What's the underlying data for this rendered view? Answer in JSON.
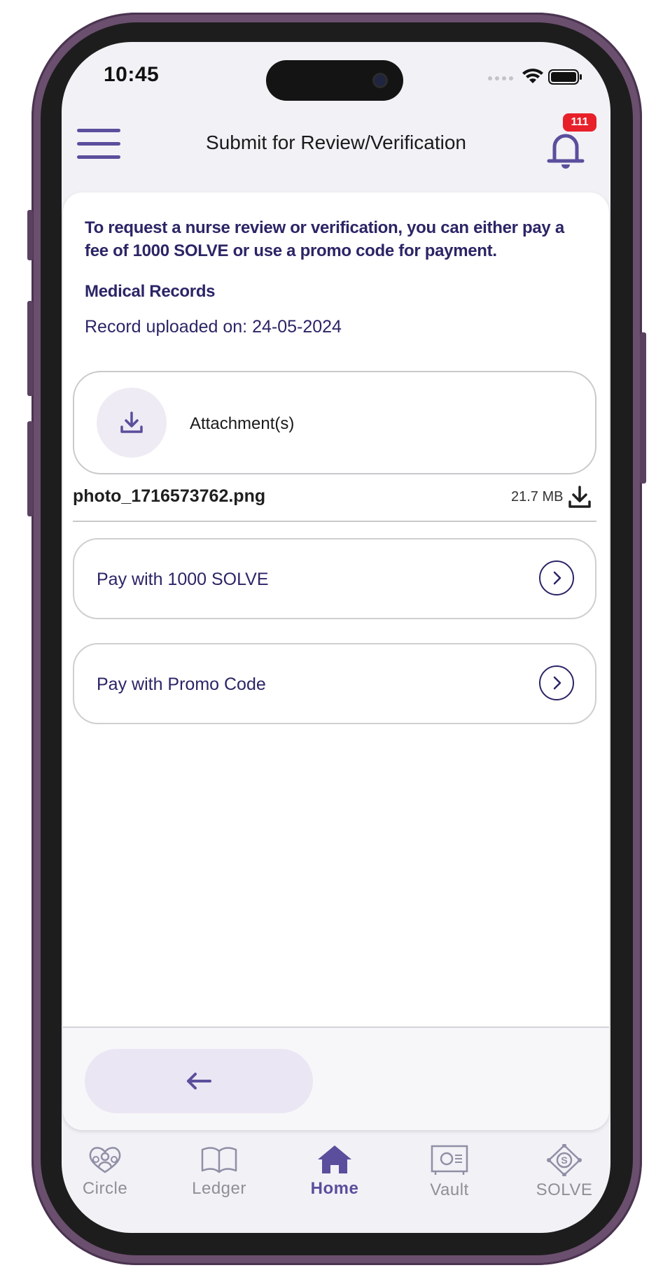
{
  "status_bar": {
    "time": "10:45"
  },
  "header": {
    "title": "Submit for Review/Verification",
    "notification_count": "111"
  },
  "intro_text": "To request a nurse review or verification, you can either pay a fee of 1000 SOLVE or use a promo code for payment.",
  "record": {
    "section_title": "Medical Records",
    "uploaded_text": "Record uploaded on: 24-05-2024"
  },
  "attachments": {
    "label": "Attachment(s)",
    "file": {
      "name": "photo_1716573762.png",
      "size": "21.7 MB"
    }
  },
  "payment_options": [
    {
      "label": "Pay with 1000 SOLVE"
    },
    {
      "label": "Pay with Promo Code"
    }
  ],
  "footer": {
    "back_icon": "arrow-left-icon"
  },
  "tabs": [
    {
      "label": "Circle",
      "icon": "circle-people-icon",
      "active": false
    },
    {
      "label": "Ledger",
      "icon": "book-icon",
      "active": false
    },
    {
      "label": "Home",
      "icon": "home-icon",
      "active": true
    },
    {
      "label": "Vault",
      "icon": "vault-icon",
      "active": false
    },
    {
      "label": "SOLVE",
      "icon": "solve-token-icon",
      "active": false
    }
  ],
  "colors": {
    "accent": "#5b4e9c",
    "text_dark": "#2b2566",
    "badge": "#e8202a",
    "pill_bg": "#ebe6f3"
  }
}
